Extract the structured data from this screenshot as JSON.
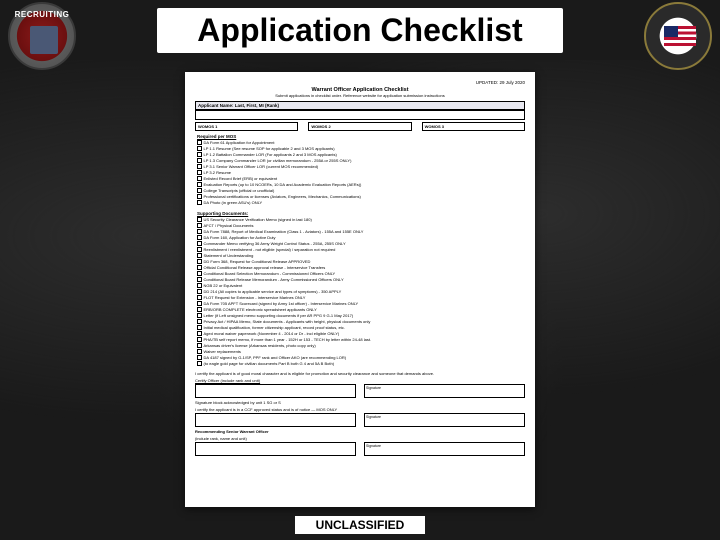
{
  "slide": {
    "title": "Application Checklist",
    "footer": "UNCLASSIFIED"
  },
  "logos": {
    "left_text": "RECRUITING",
    "right_alt": "Warrant Officer Recruiting Seal"
  },
  "doc": {
    "updated": "UPDATED: 29 July 2020",
    "heading": "Warrant Officer Application Checklist",
    "sub": "Submit applications in checklist order. Reference website for application submission instructions",
    "name_label": "Applicant Name: Last, First, MI (Rank)",
    "mos": {
      "c1": "WOMOS 1",
      "c2": "WOMOS 2",
      "c3": "WOMOS 3"
    },
    "section_required": "Required per MOS",
    "required_items": [
      "DA Form 61 Application for Appointment",
      "LP 1.1 Resume (See resume SOP for applicable 2 and 3 MOS applicants)",
      "LP 1.2 Battalion Commander LOR (For applicants 2 and 3 MOS applicants)",
      "LP 1.3 Company Commander LOR (or civilian memorandum - 255A or 255S ONLY)",
      "LP 3.1 Senior Warrant Officer LOR (current MOS recommended)",
      "LP 3.2 Resume",
      "Enlisted Record Brief (ERB) or equivalent",
      "Evaluation Reports (up to 10 NCOERs, 10 DA and Academic Evaluation Reports (AERs))",
      "College Transcripts (official or unofficial)",
      "Professional certifications or licenses (Aviators, Engineers, Mechanics, Communications)",
      "DA Photo (in green ASU's) ONLY"
    ],
    "section_supporting": "Supporting Documents:",
    "supporting_items": [
      "US Security Clearance Verification Memo (signed in last 180)",
      "AFCT / Physical Documents",
      "DA Form 7888, Report of Medical Examination (Class 1 - Aviators) - 155A and 155E ONLY",
      "DA Form 160, Application for Active Duty",
      "Commander Memo verifying 36 Army Weight Control Status - 255A, 255S ONLY",
      "Reenlistment / reenlistment - not eligible (special) / separation not required",
      "Statement of Understanding",
      "DD Form 368, Request for Conditional Release APPROVED",
      "Official Conditional Release approval release - Interservice Transfers",
      "Conditional Board Selection Memorandum - Commissioned Officers ONLY",
      "Conditional Board Release Memorandum - Army Commissioned Officers ONLY",
      "NGB 22 or Equivalent",
      "DD 214 (All copies to applicable service and types of symptoms) - 350 APPLY",
      "FLOT Request for Extension - Interservice Marines ONLY",
      "DA Form 705 APFT Scorecard (signed by Army 1st officer) - Interservice Marines ONLY",
      "ERB/ORB COMPLETE electronic spreadsheet applicants ONLY",
      "Letter (if Left unsigned memo supporting documents if per AR PPG 9 G-1 May 2017)",
      "Privacy Act / HIPAA Memo, State documents - Applicants with height, physical documents only",
      "Initial medical qualification, former citizenship applicant, record proof status, etc.",
      "Aged moral waiver paperwork (November 4 - 2014 or Dr - incl eligible ONLY)",
      "PHA/TB self report memo, if more than 1 year - 152H or 153 - TECH by letter within 24-48 last.",
      "Arkansas driver's license (Arkansas residents, photo copy only)",
      "Waiver replacements",
      "DA 4187 signed by G-1/SP, PPF rank and Officer AKO (are recommending LOR)",
      "(to eagle gold page for civilian documents Part B both G 4 and 5A B Both)"
    ],
    "certify_text": "I certify the applicant is of good moral character and is eligible for promotion and security clearance and someone that demands above.",
    "cert_label": "Certify Officer (include rank and unit)",
    "sig1_left": "Signature block acknowledged by unit 1 SG or S",
    "sig2_text": "I certify the applicant is in a CCF approved status and is of notice — MOS ONLY",
    "recommending_label": "Recommending Senior Warrant Officer",
    "recommending_sub": "(include rank, name and unit)",
    "sig_col": "Signature"
  }
}
